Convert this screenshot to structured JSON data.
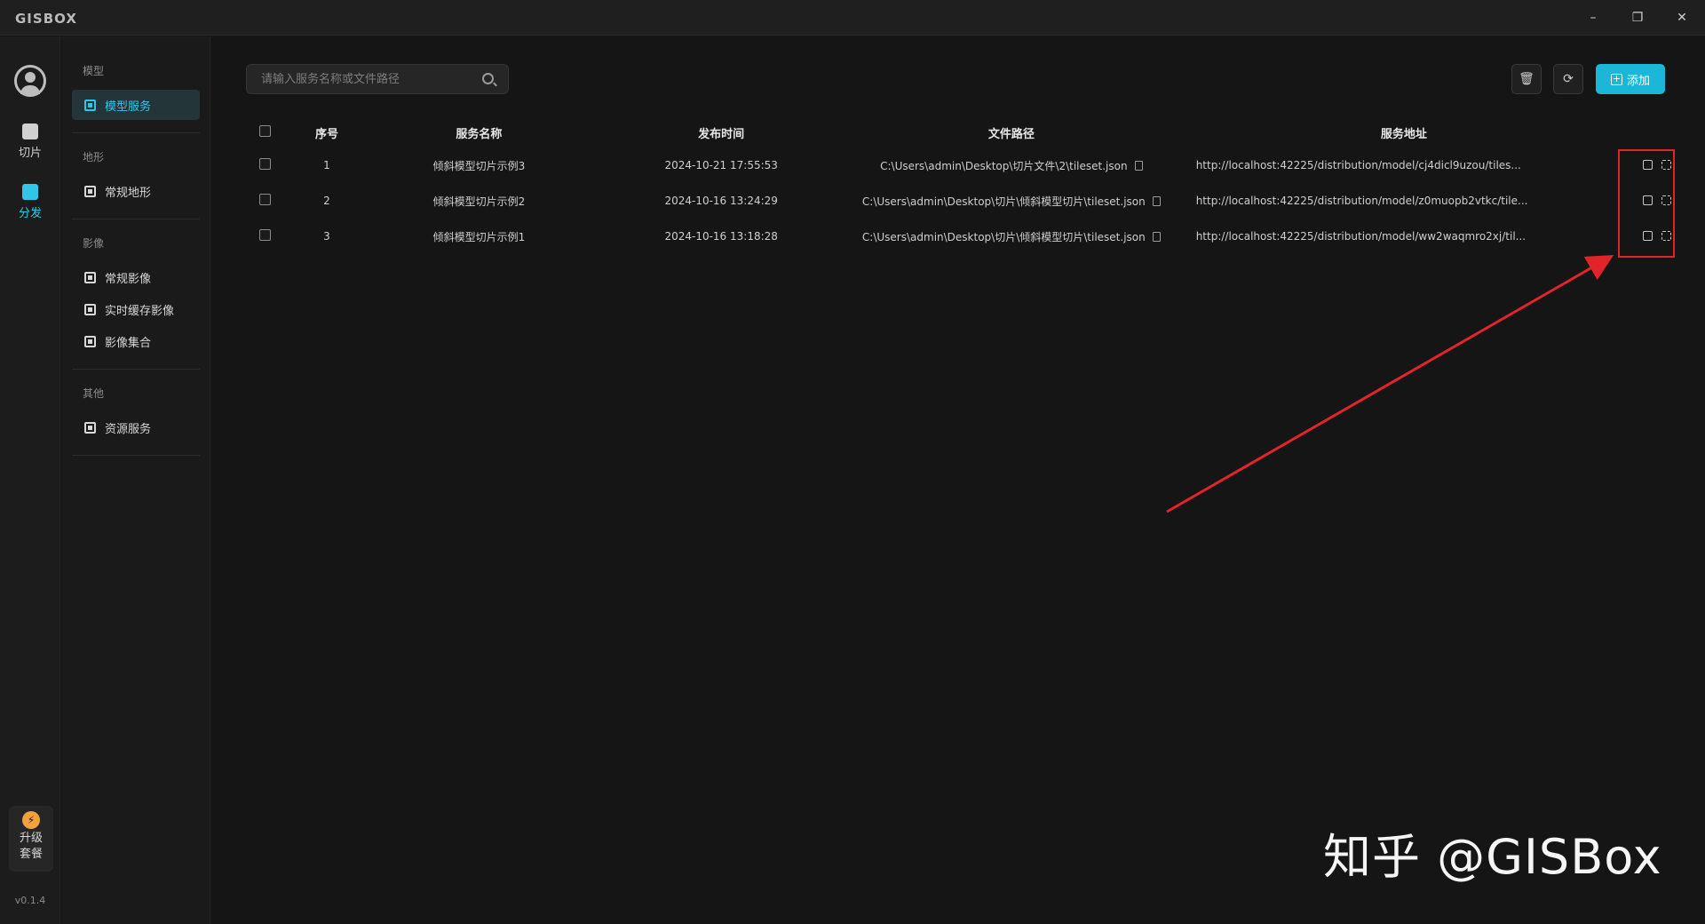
{
  "app": {
    "logo": "GISBOX",
    "window": {
      "minimize": "–",
      "maximize": "❐",
      "close": "✕"
    }
  },
  "rail": {
    "items": [
      {
        "label": "切片",
        "icon": "slice-icon"
      },
      {
        "label": "分发",
        "icon": "distribute-icon"
      }
    ],
    "upgrade": {
      "icon": "⚡",
      "line1": "升级",
      "line2": "套餐"
    },
    "version": "v0.1.4"
  },
  "sidebar": {
    "groups": [
      {
        "title": "模型",
        "items": [
          {
            "label": "模型服务",
            "active": true
          }
        ]
      },
      {
        "title": "地形",
        "items": [
          {
            "label": "常规地形"
          }
        ]
      },
      {
        "title": "影像",
        "items": [
          {
            "label": "常规影像"
          },
          {
            "label": "实时缓存影像"
          },
          {
            "label": "影像集合"
          }
        ]
      },
      {
        "title": "其他",
        "items": [
          {
            "label": "资源服务"
          }
        ]
      }
    ]
  },
  "toolbar": {
    "search_placeholder": "请输入服务名称或文件路径",
    "add_label": "添加",
    "delete_icon": "🗑",
    "refresh_icon": "⟳"
  },
  "table": {
    "headers": [
      "序号",
      "服务名称",
      "发布时间",
      "文件路径",
      "服务地址"
    ],
    "rows": [
      {
        "idx": "1",
        "name": "倾斜模型切片示例3",
        "time": "2024-10-21 17:55:53",
        "path": "C:\\Users\\admin\\Desktop\\切片文件\\2\\tileset.json",
        "url": "http://localhost:42225/distribution/model/cj4dicl9uzou/tiles..."
      },
      {
        "idx": "2",
        "name": "倾斜模型切片示例2",
        "time": "2024-10-16 13:24:29",
        "path": "C:\\Users\\admin\\Desktop\\切片\\倾斜模型切片\\tileset.json",
        "url": "http://localhost:42225/distribution/model/z0muopb2vtkc/tile..."
      },
      {
        "idx": "3",
        "name": "倾斜模型切片示例1",
        "time": "2024-10-16 13:18:28",
        "path": "C:\\Users\\admin\\Desktop\\切片\\倾斜模型切片\\tileset.json",
        "url": "http://localhost:42225/distribution/model/ww2waqmro2xj/til..."
      }
    ]
  },
  "watermark": "知乎 @GISBox",
  "colors": {
    "accent": "#1ab7d8",
    "highlight": "#e0242a"
  }
}
